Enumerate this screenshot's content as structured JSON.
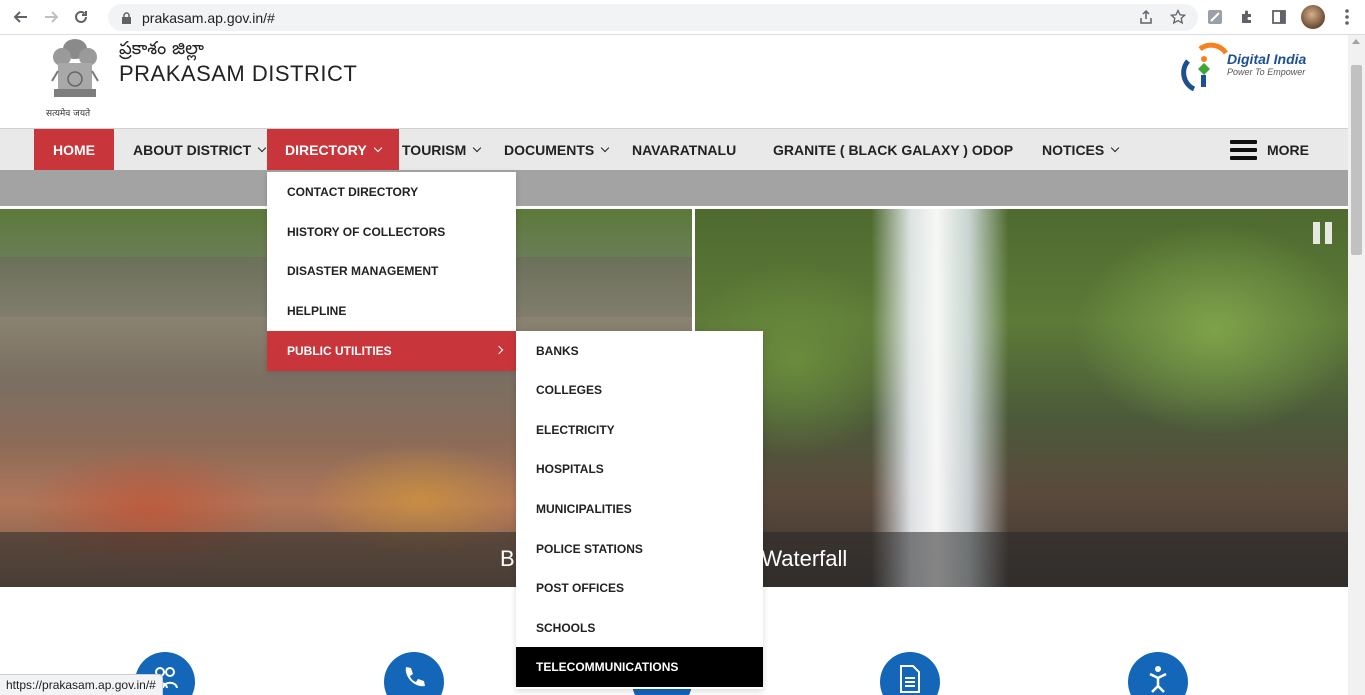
{
  "browser": {
    "url": "prakasam.ap.gov.in/#",
    "status_url": "https://prakasam.ap.gov.in/#"
  },
  "header": {
    "telugu_title": "ప్రకాశం జిల్లా",
    "title": "PRAKASAM DISTRICT",
    "emblem_motto": "सत्यमेव जयते",
    "digital_india_title": "Digital India",
    "digital_india_tagline": "Power To Empower"
  },
  "menu": {
    "home": "HOME",
    "about": "ABOUT DISTRICT",
    "directory": "DIRECTORY",
    "tourism": "TOURISM",
    "documents": "DOCUMENTS",
    "navaratnalu": "NAVARATNALU",
    "granite": "GRANITE ( BLACK GALAXY ) ODOP",
    "notices": "NOTICES",
    "more": "MORE"
  },
  "directory_dropdown": [
    "CONTACT DIRECTORY",
    "HISTORY OF COLLECTORS",
    "DISASTER MANAGEMENT",
    "HELPLINE",
    "PUBLIC UTILITIES"
  ],
  "public_utilities_submenu": [
    "BANKS",
    "COLLEGES",
    "ELECTRICITY",
    "HOSPITALS",
    "MUNICIPALITIES",
    "POLICE STATIONS",
    "POST OFFICES",
    "SCHOOLS",
    "TELECOMMUNICATIONS"
  ],
  "slider": {
    "caption": "Bhairavakona Temple And Waterfall"
  },
  "colors": {
    "brand_red": "#c8363b",
    "icon_blue": "#1466b8"
  }
}
